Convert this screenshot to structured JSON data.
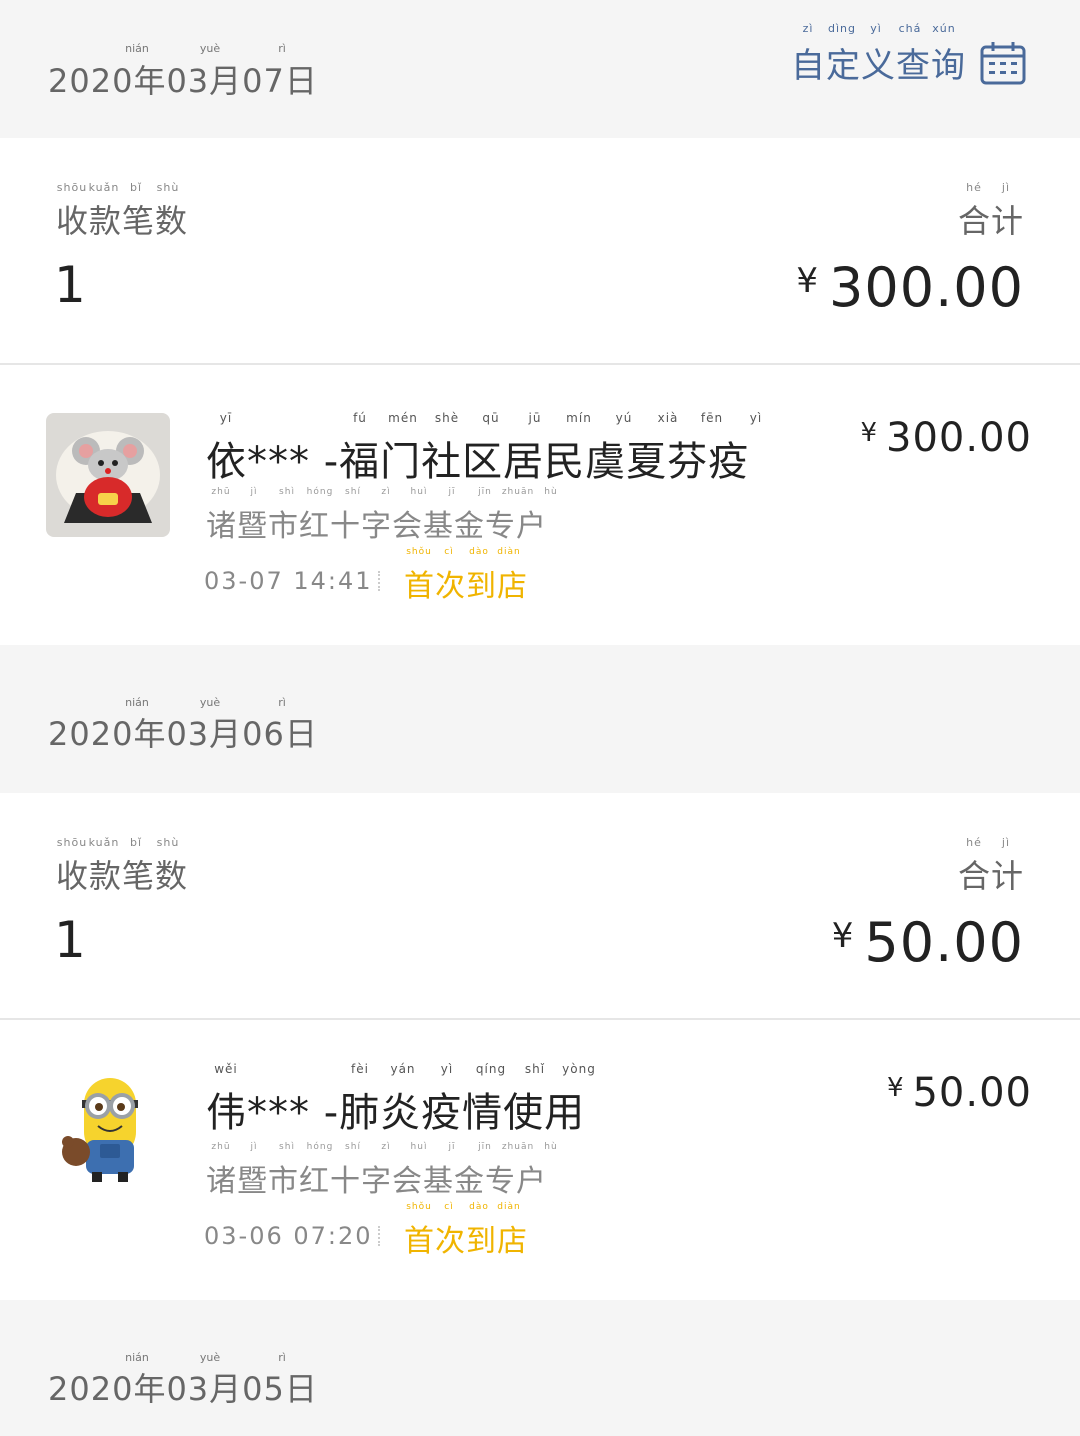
{
  "header": {
    "query_label": "自定义查询",
    "query_pinyin": [
      "zì",
      "dìng",
      "yì",
      "chá",
      "xún"
    ]
  },
  "date_pinyin": [
    "nián",
    "yuè",
    "rì"
  ],
  "labels": {
    "count_label": "收款笔数",
    "count_pinyin": [
      "shōu",
      "kuǎn",
      "bǐ",
      "shù"
    ],
    "total_label": "合计",
    "total_pinyin": [
      "hé",
      "jì"
    ],
    "sub_pinyin": [
      "zhū",
      "jì",
      "shì",
      "hóng",
      "shí",
      "zì",
      "huì",
      "jī",
      "jīn",
      "zhuān",
      "hù"
    ],
    "tag_pinyin": [
      "shǒu",
      "cì",
      "dào",
      "diàn"
    ]
  },
  "days": [
    {
      "date": "2020年03月07日",
      "count": "1",
      "yen": "¥",
      "total": "300.00",
      "record": {
        "title": "依*** -福门社区居民虞夏芬疫",
        "title_pinyin": [
          "yī",
          "fú",
          "mén",
          "shè",
          "qū",
          "jū",
          "mín",
          "yú",
          "xià",
          "fēn",
          "yì"
        ],
        "subtitle": "诸暨市红十字会基金专户",
        "time": "03-07  14:41",
        "tag": "首次到店",
        "amount": "300.00",
        "avatar": "mouse-stone-avatar"
      }
    },
    {
      "date": "2020年03月06日",
      "count": "1",
      "yen": "¥",
      "total": "50.00",
      "record": {
        "title": "伟*** -肺炎疫情使用",
        "title_pinyin": [
          "wěi",
          "fèi",
          "yán",
          "yì",
          "qíng",
          "shǐ",
          "yòng"
        ],
        "subtitle": "诸暨市红十字会基金专户",
        "time": "03-06  07:20",
        "tag": "首次到店",
        "amount": "50.00",
        "avatar": "minion-avatar"
      }
    },
    {
      "date": "2020年03月05日"
    }
  ],
  "colors": {
    "accent_blue": "#4a6a9a",
    "tag_yellow": "#f0b400",
    "background": "#f5f5f5"
  }
}
